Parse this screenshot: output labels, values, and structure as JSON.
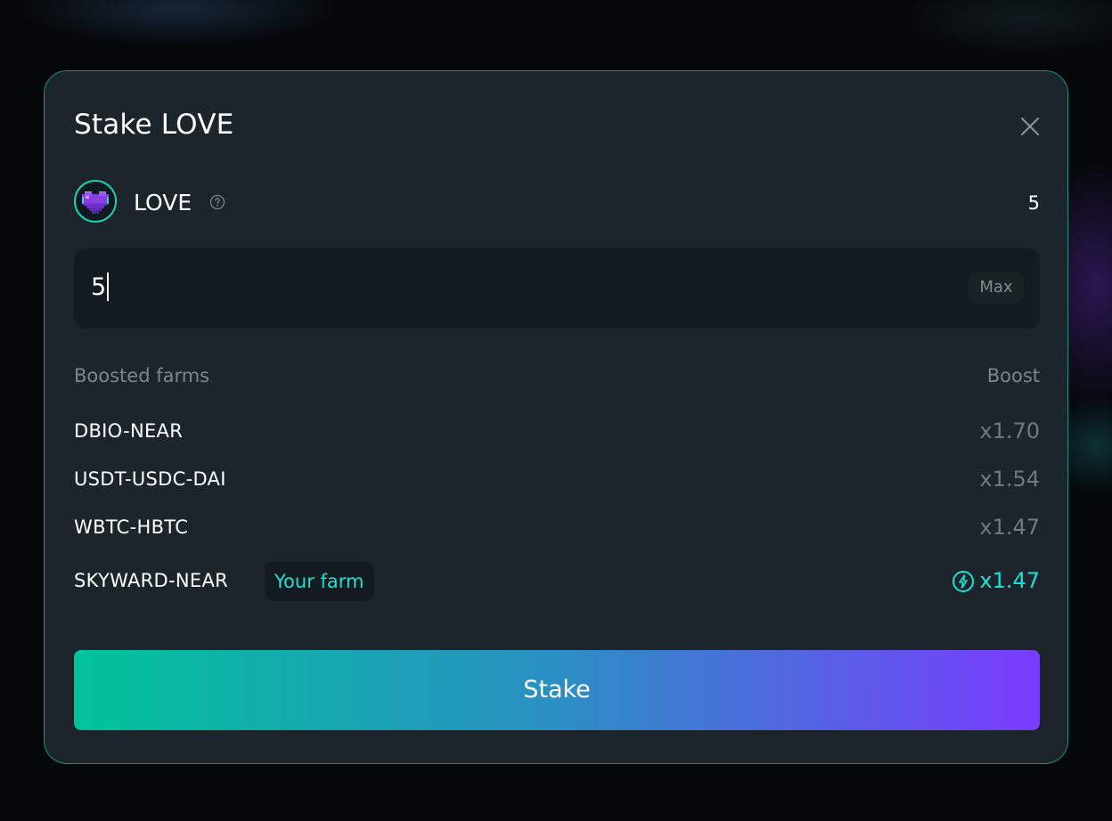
{
  "modal": {
    "title": "Stake LOVE"
  },
  "token": {
    "name": "LOVE",
    "balance": "5",
    "icon": "pixel-heart-icon"
  },
  "amount_input": {
    "value": "5",
    "max_label": "Max"
  },
  "farms": {
    "header_left": "Boosted farms",
    "header_right": "Boost",
    "items": [
      {
        "name": "DBIO-NEAR",
        "boost": "x1.70"
      },
      {
        "name": "USDT-USDC-DAI",
        "boost": "x1.54"
      },
      {
        "name": "WBTC-HBTC",
        "boost": "x1.47"
      },
      {
        "name": "SKYWARD-NEAR",
        "boost": "x1.47",
        "badge": "Your farm"
      }
    ]
  },
  "actions": {
    "stake_label": "Stake"
  },
  "colors": {
    "accent": "#19e3d2",
    "border": "#1d8f7c",
    "gradient_start": "#00c39a",
    "gradient_end": "#7a3bff"
  }
}
